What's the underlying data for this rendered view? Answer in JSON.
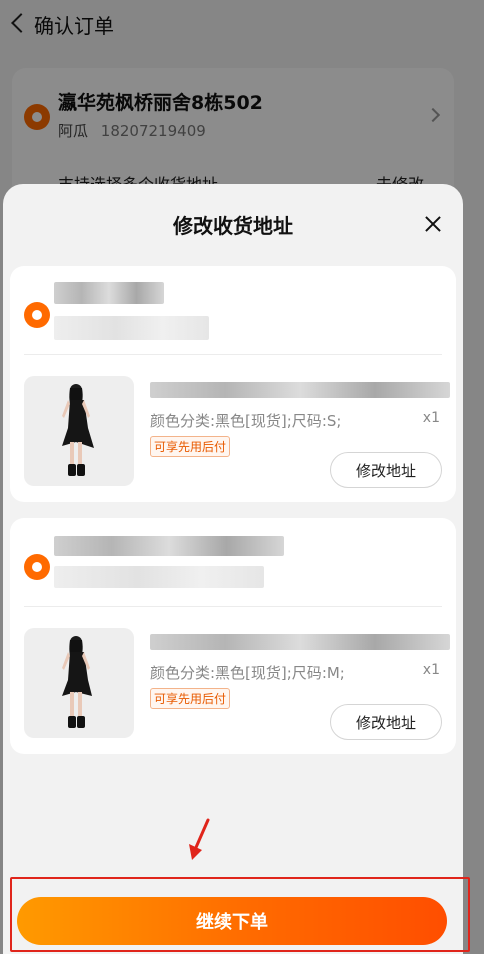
{
  "background_page": {
    "title": "确认订单",
    "address": "瀛华苑枫桥丽舍8栋502",
    "name": "阿瓜",
    "phone": "18207219409",
    "row2_left": "支持选择多个收货地址",
    "row2_right": "去修改"
  },
  "sheet": {
    "title": "修改收货地址",
    "groups": [
      {
        "sku": "颜色分类:黑色[现货];尺码:S;",
        "qty": "x1",
        "badge": "可享先用后付",
        "edit_label": "修改地址"
      },
      {
        "sku": "颜色分类:黑色[现货];尺码:M;",
        "qty": "x1",
        "badge": "可享先用后付",
        "edit_label": "修改地址"
      }
    ],
    "cta_label": "继续下单"
  },
  "colors": {
    "accent": "#ff6a00",
    "annotation": "#e0251b"
  },
  "icons": {
    "back": "chevron-left-icon",
    "close": "close-icon",
    "location": "location-pin-icon",
    "chevron_right": "chevron-right-icon"
  }
}
